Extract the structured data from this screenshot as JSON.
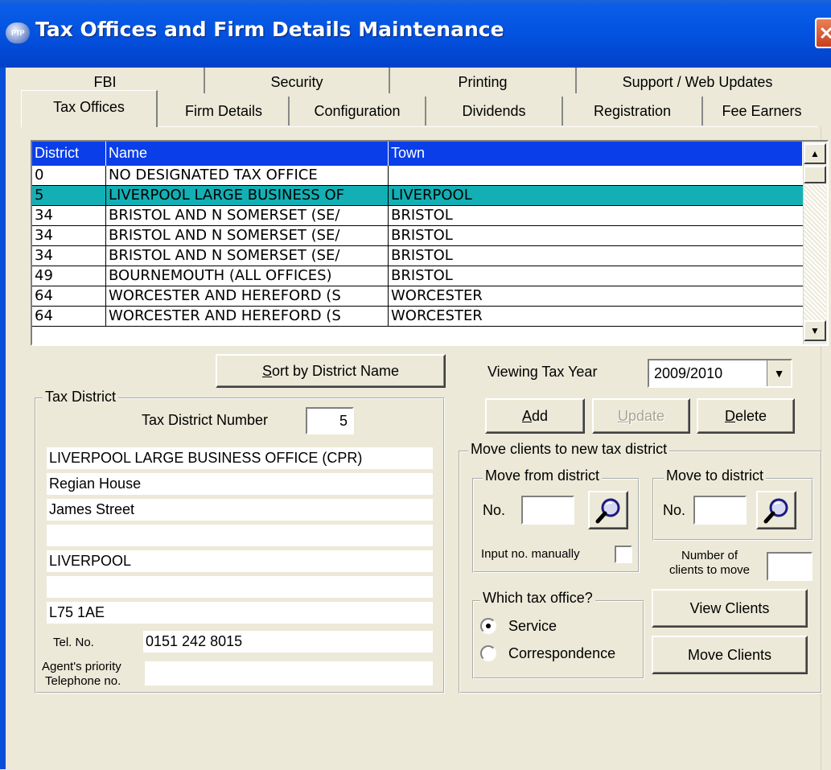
{
  "window": {
    "title": "Tax Offices and Firm Details Maintenance",
    "app_badge": "PTP"
  },
  "tabs_row1": [
    "FBI",
    "Security",
    "Printing",
    "Support / Web Updates"
  ],
  "tabs_row2": [
    "Tax Offices",
    "Firm Details",
    "Configuration",
    "Dividends",
    "Registration",
    "Fee Earners"
  ],
  "list": {
    "columns": [
      "District",
      "Name",
      "Town"
    ],
    "rows": [
      {
        "district": "0",
        "name": "NO DESIGNATED TAX OFFICE",
        "town": ""
      },
      {
        "district": "5",
        "name": "LIVERPOOL LARGE BUSINESS OF",
        "town": "LIVERPOOL"
      },
      {
        "district": "34",
        "name": "BRISTOL AND N SOMERSET (SE/",
        "town": "BRISTOL"
      },
      {
        "district": "34",
        "name": "BRISTOL AND N SOMERSET (SE/",
        "town": "BRISTOL"
      },
      {
        "district": "34",
        "name": "BRISTOL AND N SOMERSET (SE/",
        "town": "BRISTOL"
      },
      {
        "district": "49",
        "name": "BOURNEMOUTH (ALL OFFICES)",
        "town": "BRISTOL"
      },
      {
        "district": "64",
        "name": "WORCESTER AND HEREFORD (S",
        "town": "WORCESTER"
      },
      {
        "district": "64",
        "name": "WORCESTER AND HEREFORD (S",
        "town": "WORCESTER"
      }
    ]
  },
  "sort_button": {
    "pre": "",
    "accel": "S",
    "post": "ort by District Name"
  },
  "tax_year": {
    "label": "Viewing Tax Year",
    "value": "2009/2010"
  },
  "actions": {
    "add": {
      "accel": "A",
      "post": "dd"
    },
    "update": {
      "accel": "U",
      "post": "pdate"
    },
    "delete": {
      "accel": "D",
      "post": "elete"
    }
  },
  "tax_district": {
    "legend": "Tax District",
    "number_label": "Tax District Number",
    "number_value": "5",
    "address": [
      "LIVERPOOL LARGE BUSINESS OFFICE (CPR)",
      "Regian House",
      "James Street",
      "",
      "LIVERPOOL",
      "",
      "L75 1AE"
    ],
    "tel_label": "Tel. No.",
    "tel_value": "0151 242 8015",
    "agent_label_1": "Agent's priority",
    "agent_label_2": "Telephone no.",
    "agent_value": ""
  },
  "move": {
    "legend": "Move clients to new tax district",
    "from_legend": "Move from district",
    "to_legend": "Move to district",
    "no_label": "No.",
    "manual_label": "Input no. manually",
    "count_label_1": "Number of",
    "count_label_2": "clients to move",
    "which_legend": "Which tax office?",
    "options": [
      "Service",
      "Correspondence"
    ],
    "selected": "Service",
    "view_clients": "View Clients",
    "move_clients": "Move Clients"
  },
  "colors": {
    "titlebar": "#0352e0",
    "list_header": "#0a3ee8",
    "selected_row": "#12b0b5",
    "face": "#ece9d8"
  },
  "icons": [
    "search-magnifier-icon",
    "scroll-up-icon",
    "scroll-down-icon",
    "dropdown-arrow-icon",
    "close-icon"
  ]
}
